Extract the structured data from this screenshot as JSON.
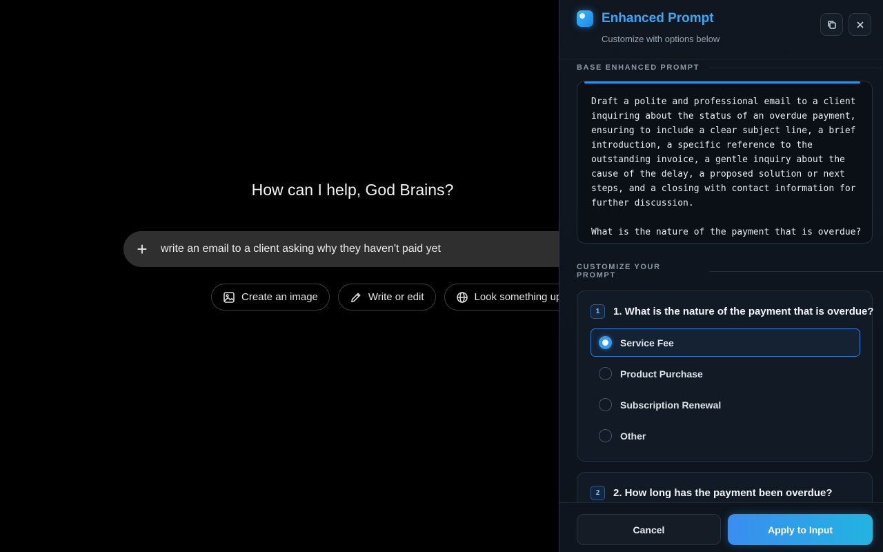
{
  "chat": {
    "greeting": "How can I help, God Brains?",
    "input_value": "write an email to a client asking why they haven't paid yet",
    "chips": [
      {
        "label": "Create an image",
        "icon": "image-icon"
      },
      {
        "label": "Write or edit",
        "icon": "pencil-icon"
      },
      {
        "label": "Look something up",
        "icon": "globe-icon"
      }
    ]
  },
  "panel": {
    "title": "Enhanced Prompt",
    "subtitle": "Customize with options below",
    "base_label": "BASE ENHANCED PROMPT",
    "base_prompt": "Draft a polite and professional email to a client inquiring about the status of an overdue payment, ensuring to include a clear subject line, a brief introduction, a specific reference to the outstanding invoice, a gentle inquiry about the cause of the delay, a proposed solution or next steps, and a closing with contact information for further discussion.\n\nWhat is the nature of the payment that is overdue?",
    "customize_label": "CUSTOMIZE YOUR PROMPT",
    "questions": [
      {
        "number": "1",
        "text": "1. What is the nature of the payment that is overdue?",
        "options": [
          "Service Fee",
          "Product Purchase",
          "Subscription Renewal",
          "Other"
        ],
        "selected": "Service Fee"
      },
      {
        "number": "2",
        "text": "2. How long has the payment been overdue?"
      }
    ],
    "cancel_label": "Cancel",
    "apply_label": "Apply to Input"
  },
  "colors": {
    "accent": "#3aa7f5",
    "apply_gradient_start": "#3a8df0",
    "apply_gradient_end": "#22b4e0"
  }
}
